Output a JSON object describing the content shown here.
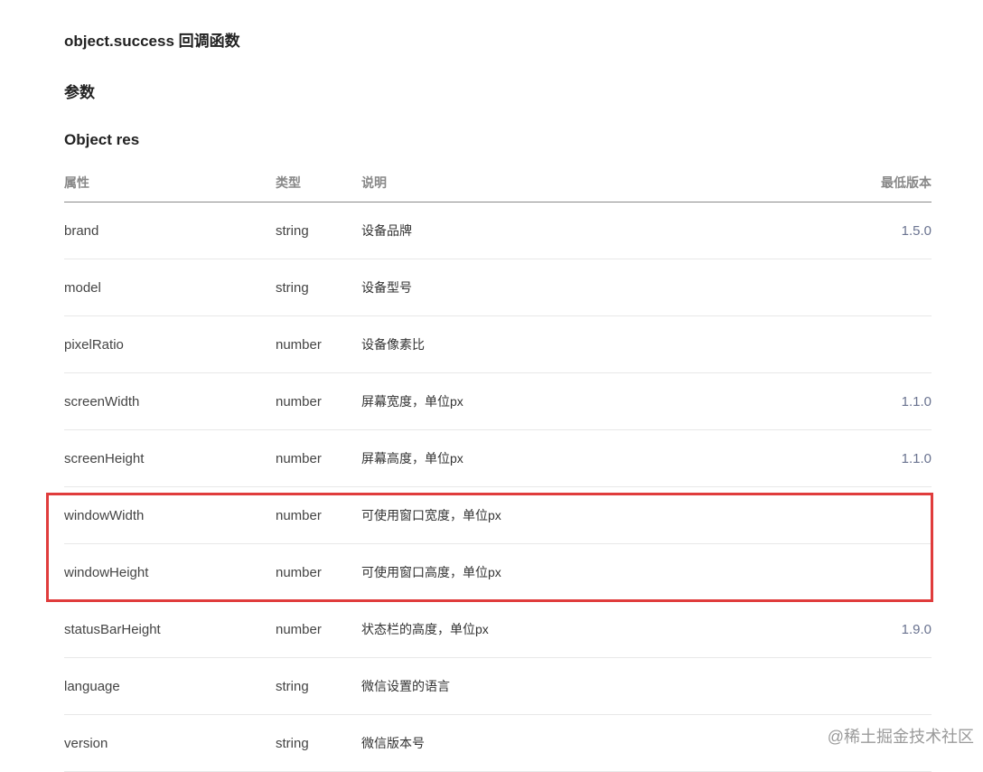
{
  "headings": {
    "callback": "object.success 回调函数",
    "params": "参数",
    "object": "Object res"
  },
  "table": {
    "headers": [
      "属性",
      "类型",
      "说明",
      "最低版本"
    ],
    "rows": [
      {
        "prop": "brand",
        "type": "string",
        "desc": "设备品牌",
        "version": "1.5.0"
      },
      {
        "prop": "model",
        "type": "string",
        "desc": "设备型号",
        "version": ""
      },
      {
        "prop": "pixelRatio",
        "type": "number",
        "desc": "设备像素比",
        "version": ""
      },
      {
        "prop": "screenWidth",
        "type": "number",
        "desc": "屏幕宽度，单位px",
        "version": "1.1.0"
      },
      {
        "prop": "screenHeight",
        "type": "number",
        "desc": "屏幕高度，单位px",
        "version": "1.1.0"
      },
      {
        "prop": "windowWidth",
        "type": "number",
        "desc": "可使用窗口宽度，单位px",
        "version": ""
      },
      {
        "prop": "windowHeight",
        "type": "number",
        "desc": "可使用窗口高度，单位px",
        "version": ""
      },
      {
        "prop": "statusBarHeight",
        "type": "number",
        "desc": "状态栏的高度，单位px",
        "version": "1.9.0"
      },
      {
        "prop": "language",
        "type": "string",
        "desc": "微信设置的语言",
        "version": ""
      },
      {
        "prop": "version",
        "type": "string",
        "desc": "微信版本号",
        "version": ""
      }
    ]
  },
  "watermark": "@稀土掘金技术社区",
  "colors": {
    "highlight": "#e03c3c",
    "version_text": "#6a7390"
  }
}
